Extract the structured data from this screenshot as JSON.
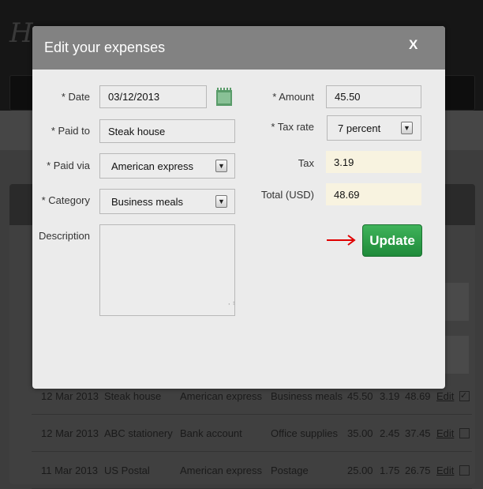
{
  "background": {
    "logo": "Hu",
    "rows": [
      {
        "date": "12 Mar 2013",
        "paid_to": "Steak house",
        "paid_via": "American express",
        "category": "Business meals",
        "amount": "45.50",
        "tax": "3.19",
        "total": "48.69",
        "edit": "Edit",
        "checked": true
      },
      {
        "date": "12 Mar 2013",
        "paid_to": "ABC stationery",
        "paid_via": "Bank account",
        "category": "Office supplies",
        "amount": "35.00",
        "tax": "2.45",
        "total": "37.45",
        "edit": "Edit",
        "checked": false
      },
      {
        "date": "11 Mar 2013",
        "paid_to": "US Postal",
        "paid_via": "American express",
        "category": "Postage",
        "amount": "25.00",
        "tax": "1.75",
        "total": "26.75",
        "edit": "Edit",
        "checked": false
      }
    ]
  },
  "dialog": {
    "title": "Edit your expenses",
    "close": "X",
    "date_label": "* Date",
    "date": "03/12/2013",
    "paid_to_label": "* Paid to",
    "paid_to": "Steak house",
    "paid_via_label": "* Paid via",
    "paid_via": "American express",
    "category_label": "* Category",
    "category": "Business meals",
    "description_label": "Description",
    "description": "",
    "amount_label": "* Amount",
    "amount": "45.50",
    "tax_rate_label": "* Tax rate",
    "tax_rate": "7 percent",
    "tax_label": "Tax",
    "tax": "3.19",
    "total_label": "Total (USD)",
    "total": "48.69",
    "update": "Update"
  },
  "colors": {
    "update_button": "#2a9d48",
    "arrow": "#e00000",
    "readonly_field": "#f8f3e0",
    "header": "#828282"
  }
}
